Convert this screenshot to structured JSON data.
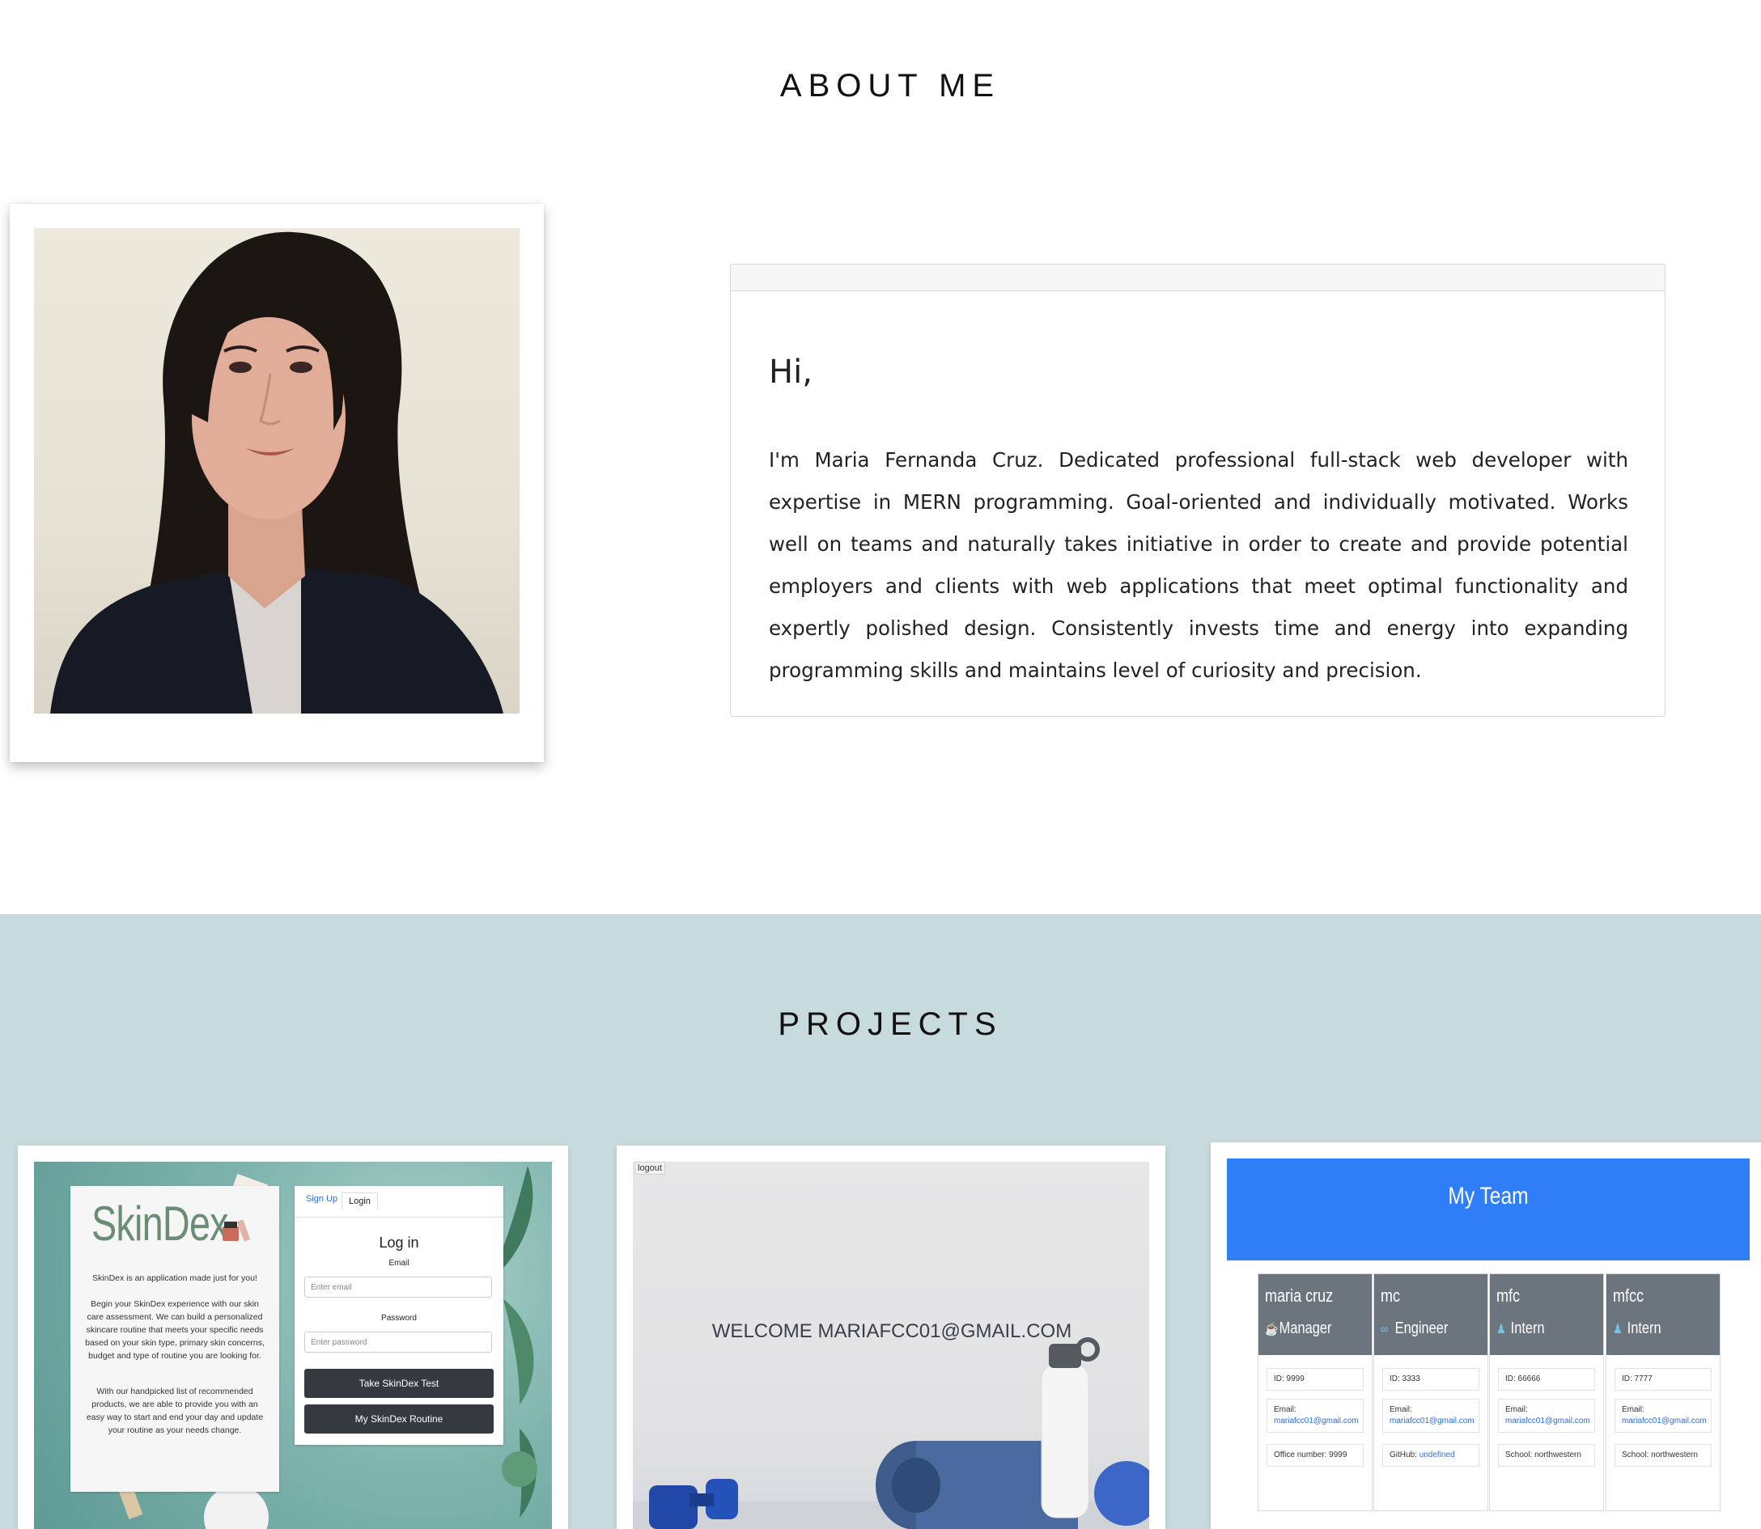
{
  "about": {
    "heading": "ABOUT ME",
    "greeting": "Hi,",
    "bio": "I'm Maria Fernanda Cruz. Dedicated professional full-stack web developer with expertise in MERN programming. Goal-oriented and individually motivated. Works well on teams and naturally takes initiative in order to create and provide potential employers and clients with web applications that meet optimal functionality and expertly polished design. Consistently invests time and energy into expanding programming skills and maintains level of curiosity and precision."
  },
  "projects": {
    "heading": "PROJECTS",
    "skindex": {
      "logo": "SkinDex",
      "intro": "SkinDex is an application made just for you!",
      "paragraph1": "Begin your SkinDex experience with our skin care assessment. We can build a personalized skincare routine that meets your specific needs based on your skin type, primary skin concerns, budget and type of routine you are looking for.",
      "paragraph2": "With our handpicked list of recommended products, we are able to provide you with an easy way to start and end your day and update your routine as your needs change.",
      "tab_signup": "Sign Up",
      "tab_login": "Login",
      "login_title": "Log in",
      "email_label": "Email",
      "email_placeholder": "Enter email",
      "password_label": "Password",
      "password_placeholder": "Enter password",
      "test_button": "Take SkinDex Test",
      "routine_button": "My SkinDex Routine"
    },
    "fitness": {
      "logout": "logout",
      "welcome": "WELCOME MARIAFCC01@GMAIL.COM"
    },
    "team": {
      "title": "My Team",
      "members": [
        {
          "name": "maria cruz",
          "role": "Manager",
          "role_icon": "coffee-icon",
          "id": "ID: 9999",
          "email_label": "Email:",
          "email": "mariafcc01@gmail.com",
          "extra_label": "Office number: 9999",
          "extra_value": ""
        },
        {
          "name": "mc",
          "role": "Engineer",
          "role_icon": "glasses-icon",
          "id": "ID: 3333",
          "email_label": "Email:",
          "email": "mariafcc01@gmail.com",
          "extra_label": "GitHub:",
          "extra_value": "undefined"
        },
        {
          "name": "mfc",
          "role": "Intern",
          "role_icon": "graduate-icon",
          "id": "ID: 66666",
          "email_label": "Email:",
          "email": "mariafcc01@gmail.com",
          "extra_label": "School: northwestern",
          "extra_value": ""
        },
        {
          "name": "mfcc",
          "role": "Intern",
          "role_icon": "graduate-icon",
          "id": "ID: 7777",
          "email_label": "Email:",
          "email": "mariafcc01@gmail.com",
          "extra_label": "School: northwestern",
          "extra_value": ""
        }
      ]
    }
  },
  "colors": {
    "projects_band": "#c7dadd",
    "team_header": "#2f7ef7",
    "card_header": "#6c757d",
    "skindex_button": "#343a40"
  }
}
